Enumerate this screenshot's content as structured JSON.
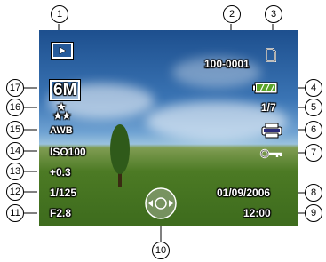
{
  "play_icon": "play-mode-icon",
  "file_number": "100-0001",
  "resolution": "6M",
  "quality_stars": "★★★",
  "white_balance": "AWB",
  "iso": "ISO100",
  "exposure": "+0.3",
  "shutter": "1/125",
  "aperture": "F2.8",
  "image_count": "1/7",
  "date": "01/09/2006",
  "time": "12:00",
  "callouts": [
    "1",
    "2",
    "3",
    "4",
    "5",
    "6",
    "7",
    "8",
    "9",
    "10",
    "11",
    "12",
    "13",
    "14",
    "15",
    "16",
    "17"
  ]
}
